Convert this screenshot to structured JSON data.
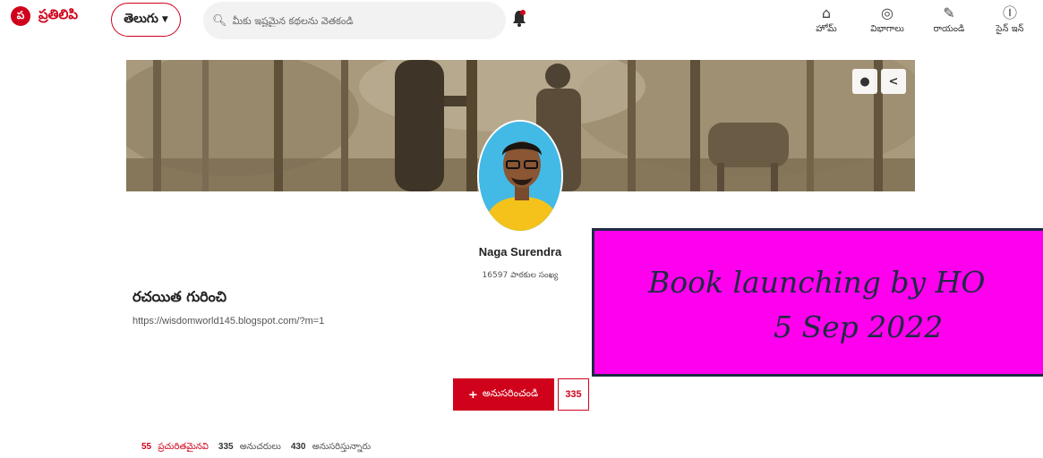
{
  "brand": {
    "logo_glyph": "ప",
    "name": "ప్రతిలిపి",
    "color": "#d0021b"
  },
  "language": {
    "selected": "తెలుగు"
  },
  "search": {
    "placeholder": "మీకు ఇష్టమైన కథలను వెతకండి"
  },
  "nav": [
    {
      "label": "హోమ్",
      "icon": "home-icon"
    },
    {
      "label": "విభాగాలు",
      "icon": "compass-icon"
    },
    {
      "label": "రాయండి",
      "icon": "pencil-icon"
    },
    {
      "label": "సైన్ ఇన్",
      "icon": "user-circle-icon"
    }
  ],
  "cover": {
    "actions": [
      "info-icon",
      "share-icon"
    ]
  },
  "profile": {
    "name": "Naga Surendra",
    "readers_count": "16597",
    "readers_label": "పాఠకుల సంఖ్య",
    "about_title": "రచయిత గురించి",
    "about_link": "https://wisdomworld145.blogspot.com/?m=1"
  },
  "follow": {
    "label": "అనుసరించండి",
    "count": "335"
  },
  "stats": [
    {
      "value": "55",
      "label": "ప్రచురితమైనవి"
    },
    {
      "value": "335",
      "label": "అనుచరులు"
    },
    {
      "value": "430",
      "label": "అనుసరిస్తున్నారు"
    }
  ],
  "banner": {
    "line1": "Book launching by HO",
    "line2": "5 Sep 2022",
    "background": "#ff00ee",
    "text_color": "#1f2a44"
  }
}
